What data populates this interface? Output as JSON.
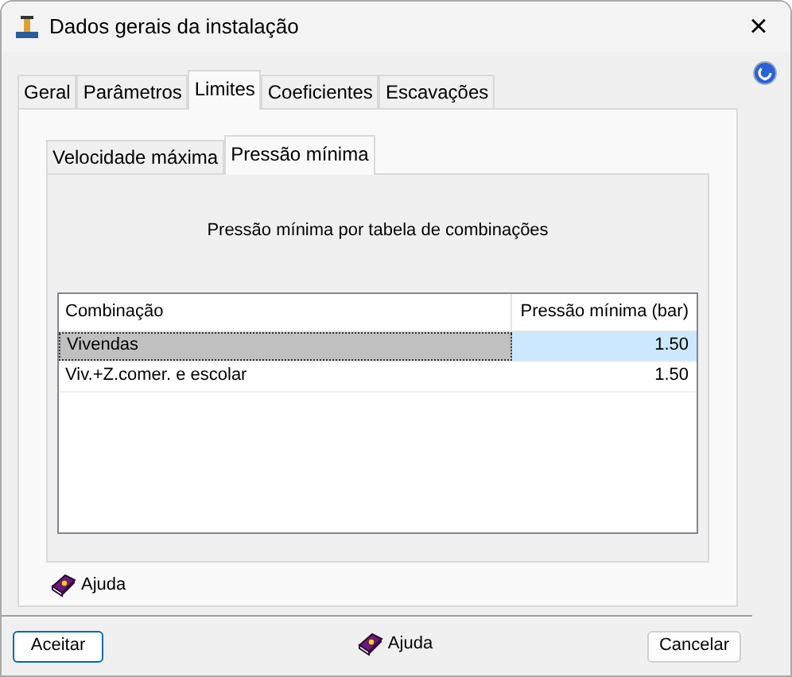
{
  "window": {
    "title": "Dados gerais da instalação",
    "close": "×"
  },
  "tabs": [
    {
      "label": "Geral",
      "selected": false
    },
    {
      "label": "Parâmetros",
      "selected": false
    },
    {
      "label": "Limites",
      "selected": true
    },
    {
      "label": "Coeficientes",
      "selected": false
    },
    {
      "label": "Escavações",
      "selected": false
    }
  ],
  "subtabs": [
    {
      "label": "Velocidade máxima",
      "selected": false
    },
    {
      "label": "Pressão mínima",
      "selected": true
    }
  ],
  "heading": "Pressão mínima por tabela de combinações",
  "table": {
    "columns": [
      "Combinação",
      "Pressão mínima (bar)"
    ],
    "rows": [
      {
        "cells": [
          "Vivendas",
          "1.50"
        ],
        "selected": true
      },
      {
        "cells": [
          "Viv.+Z.comer. e escolar",
          "1.50"
        ],
        "selected": false
      }
    ]
  },
  "panel_help": "Ajuda",
  "footer": {
    "accept": "Aceitar",
    "help": "Ajuda",
    "cancel": "Cancelar"
  }
}
